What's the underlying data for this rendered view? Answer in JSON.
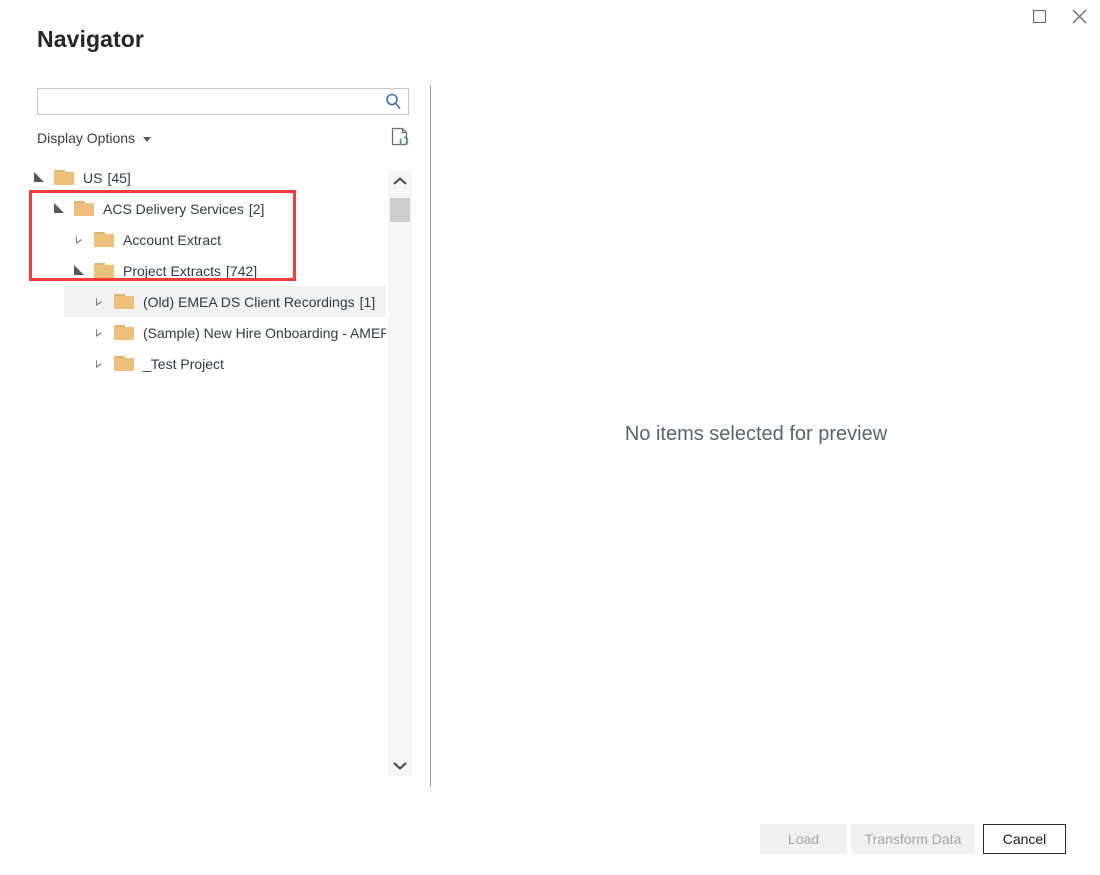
{
  "window": {
    "title": "Navigator",
    "controls": [
      {
        "name": "maximize-button",
        "icon": "maximize-icon",
        "label": "Maximize"
      },
      {
        "name": "close-button",
        "icon": "close-icon",
        "label": "Close"
      }
    ]
  },
  "search": {
    "value": "",
    "placeholder": "",
    "icon": "search-icon",
    "icon_color": "#2f6ca8"
  },
  "toolbar": {
    "display_options_label": "Display Options",
    "display_options_caret": "chevron-down-icon",
    "refresh_icon": "page-refresh-icon",
    "refresh_accent": "#4f9b7a"
  },
  "tree": {
    "items": [
      {
        "label": "US",
        "count": "[45]",
        "indent": 0,
        "state": "expanded",
        "hover": false
      },
      {
        "label": "ACS Delivery Services",
        "count": "[2]",
        "indent": 1,
        "state": "expanded",
        "hover": false
      },
      {
        "label": "Account Extract",
        "count": "",
        "indent": 2,
        "state": "collapsed",
        "hover": false
      },
      {
        "label": "Project Extracts",
        "count": "[742]",
        "indent": 2,
        "state": "expanded",
        "hover": false
      },
      {
        "label": "(Old) EMEA DS Client Recordings",
        "count": "[1]",
        "indent": 3,
        "state": "collapsed",
        "hover": true
      },
      {
        "label": "(Sample) New Hire Onboarding - AMER",
        "count": "",
        "indent": 3,
        "state": "collapsed",
        "hover": false
      },
      {
        "label": "_Test Project",
        "count": "",
        "indent": 3,
        "state": "collapsed",
        "hover": false
      }
    ],
    "folder_color": "#ecc07a"
  },
  "scrollbar": {
    "up_icon": "chevron-up-icon",
    "down_icon": "chevron-down-icon",
    "thumb_name": "scrollbar-thumb"
  },
  "preview": {
    "empty_message": "No items selected for preview"
  },
  "footer": {
    "load_label": "Load",
    "load_enabled": false,
    "transform_label": "Transform Data",
    "transform_enabled": false,
    "cancel_label": "Cancel",
    "cancel_enabled": true
  },
  "annotation": {
    "color": "#f63b3b",
    "highlights": [
      "ACS Delivery Services [2]",
      "Account Extract",
      "Project Extracts [742]"
    ]
  }
}
